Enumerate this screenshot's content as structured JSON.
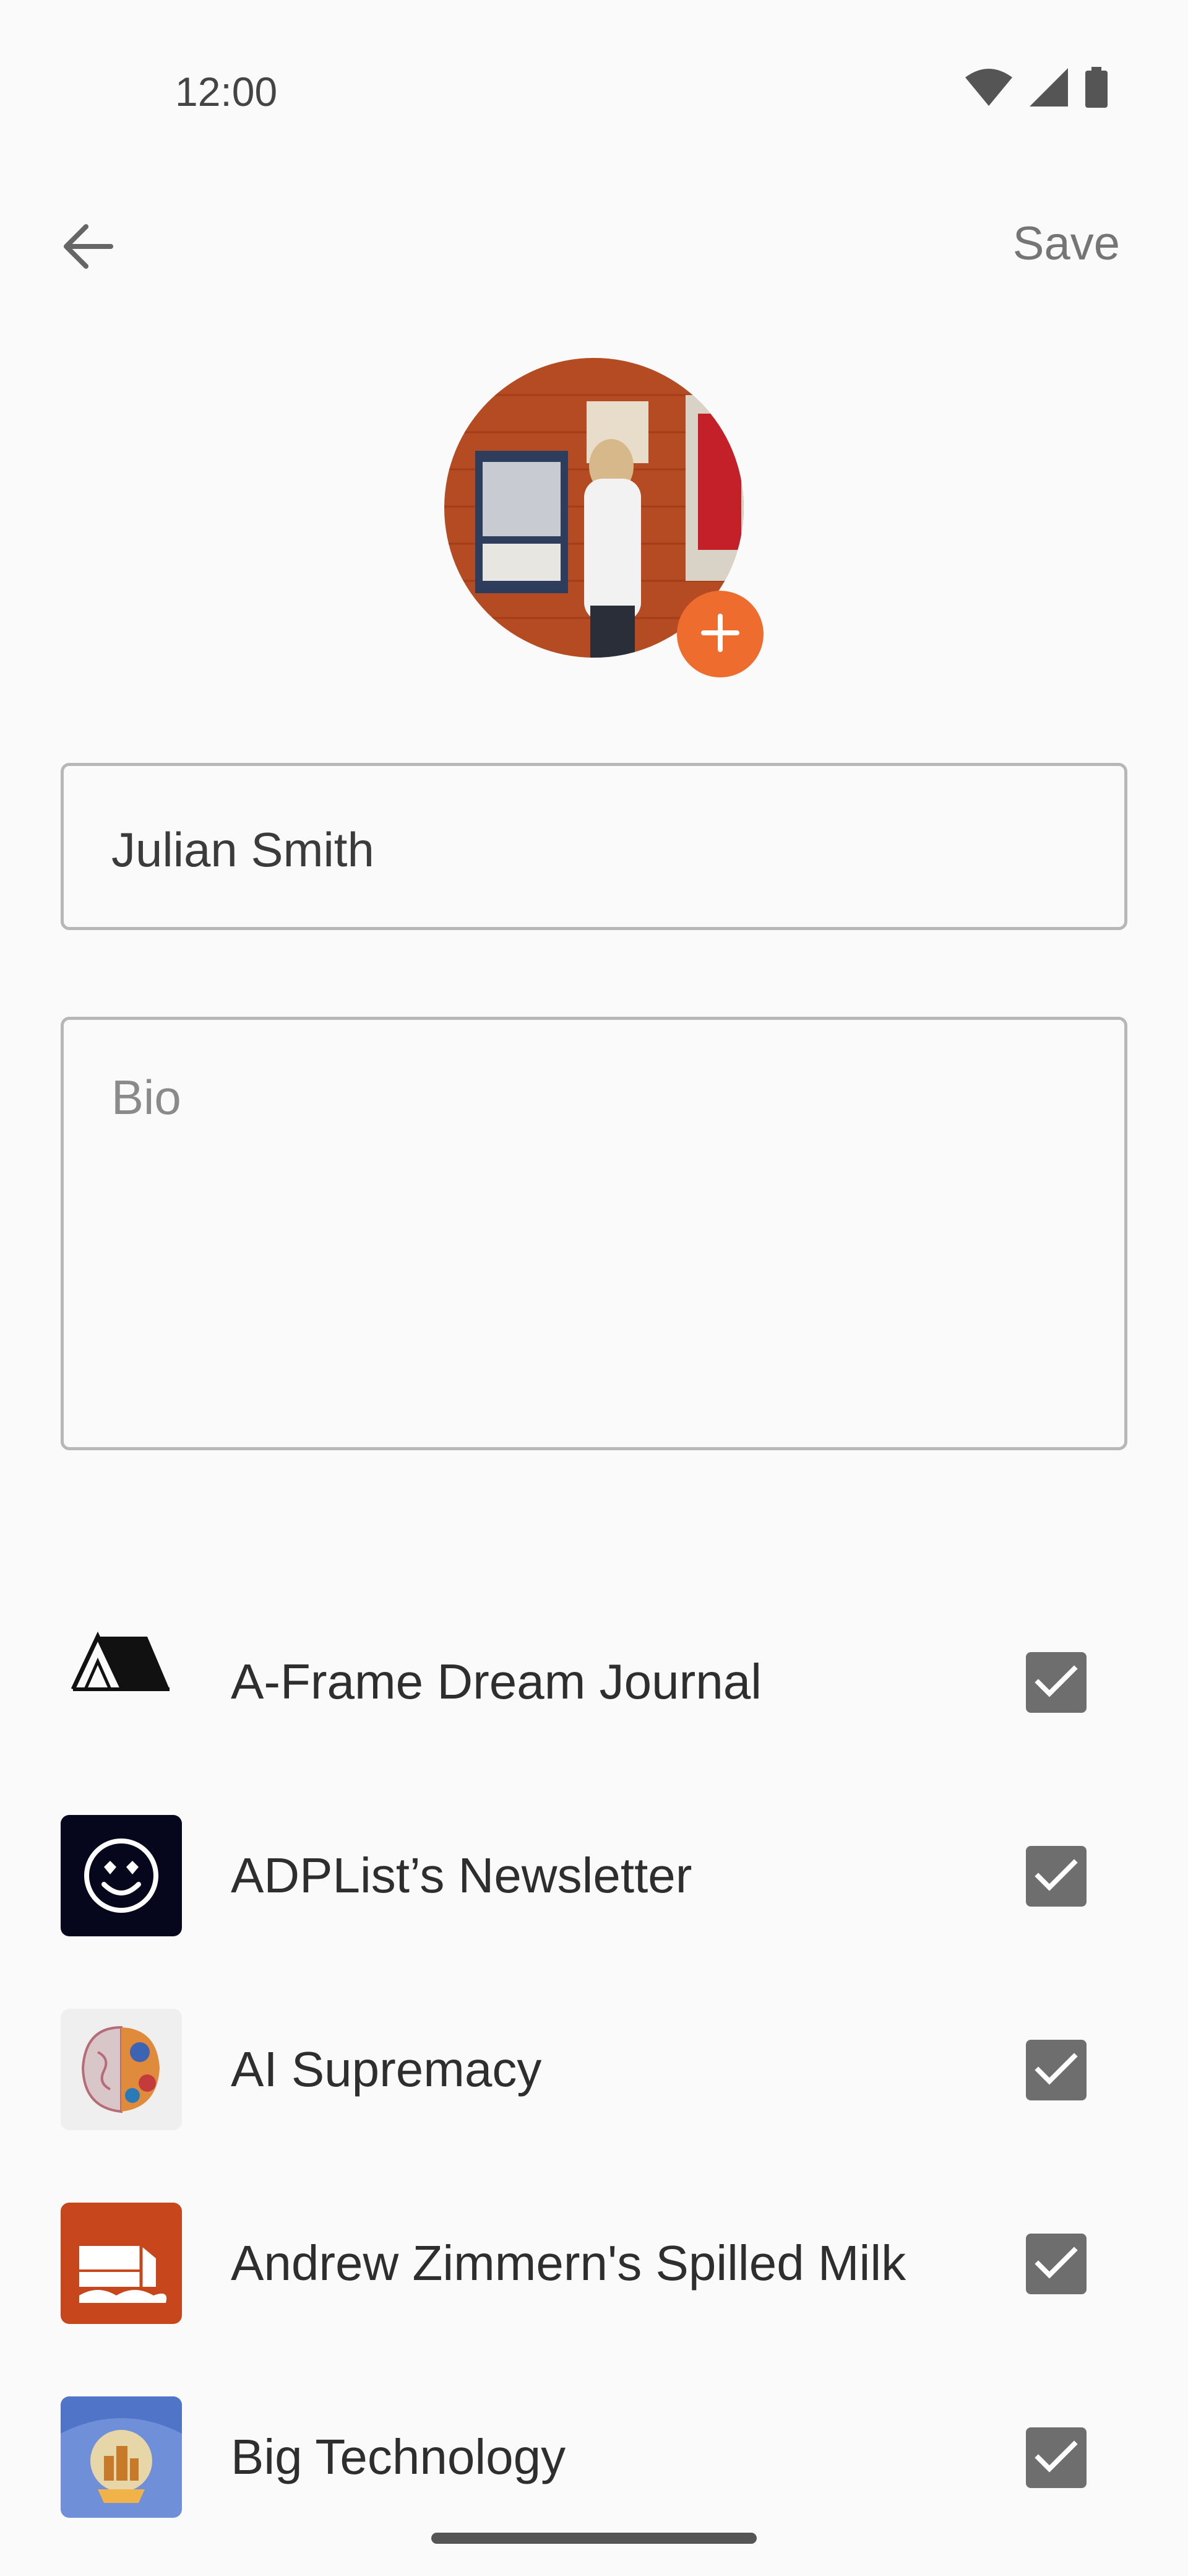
{
  "status_bar": {
    "time": "12:00",
    "icons": [
      "wifi-icon",
      "signal-icon",
      "battery-icon"
    ]
  },
  "app_bar": {
    "back_icon": "arrow-left-icon",
    "save_label": "Save"
  },
  "profile": {
    "avatar_icon": "profile-photo",
    "add_photo_icon": "plus-icon",
    "name_value": "Julian Smith",
    "bio_placeholder": "Bio",
    "bio_value": ""
  },
  "publications": [
    {
      "name": "A-Frame Dream Journal",
      "icon": "a-frame-logo",
      "checked": true
    },
    {
      "name": "ADPList’s Newsletter",
      "icon": "heart-eyes-smiley-logo",
      "checked": true
    },
    {
      "name": "AI Supremacy",
      "icon": "brain-art-logo",
      "checked": true
    },
    {
      "name": "Andrew Zimmern's Spilled Milk",
      "icon": "milk-carton-logo",
      "checked": true
    },
    {
      "name": "Big Technology",
      "icon": "city-globe-logo",
      "checked": true
    }
  ],
  "colors": {
    "accent": "#ef6c2f",
    "checkbox": "#6e6e6e",
    "background": "#fafafa"
  }
}
